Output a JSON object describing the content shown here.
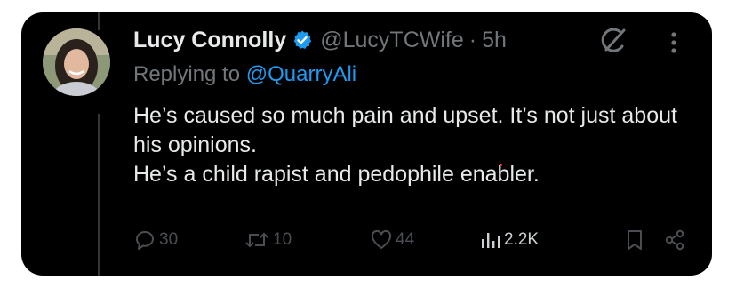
{
  "tweet": {
    "author": {
      "name": "Lucy Connolly",
      "handle": "@LucyTCWife",
      "verified": true,
      "verified_color": "#1d9bf0"
    },
    "separator": "·",
    "time": "5h",
    "replying_prefix": "Replying to",
    "replying_to": "@QuarryAli",
    "body_lines": [
      "He’s caused so much pain and upset. It’s not just about his opinions.",
      "He’s a child rapist and pedophile enabler."
    ],
    "actions": {
      "replies": "30",
      "reposts": "10",
      "likes": "44",
      "views": "2.2K"
    },
    "icons": {
      "grok": "grok-icon",
      "more": "more-dots-icon",
      "reply": "reply-icon",
      "repost": "repost-icon",
      "like": "heart-icon",
      "views": "views-chart-icon",
      "bookmark": "bookmark-icon",
      "share": "share-icon"
    },
    "colors": {
      "background": "#000000",
      "text": "#e7e9ea",
      "muted": "#71767b",
      "link": "#1d9bf0"
    }
  }
}
